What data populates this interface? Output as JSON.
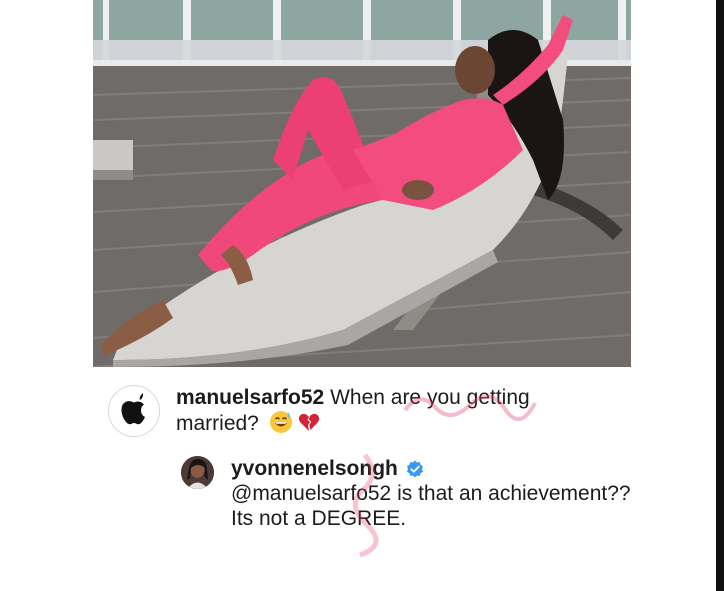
{
  "photo": {
    "alt": "Woman in pink outfit reclining on a lounge chair"
  },
  "comments": [
    {
      "username": "manuelsarfo52",
      "text": " When are you getting married?",
      "emojis": [
        "grinning-sweat-emoji",
        "broken-heart-emoji"
      ]
    },
    {
      "username": "yvonnenelsongh",
      "verified": true,
      "mention": "@manuelsarfo52",
      "text": " is that an achievement?? Its not a DEGREE."
    }
  ],
  "colors": {
    "outfit": "#f0487a",
    "text": "#1c1c1c",
    "verified_badge": "#3897f0",
    "right_bar": "#111111"
  },
  "icons": {
    "avatar1": "apple-logo-icon",
    "verified": "verified-badge-icon"
  }
}
